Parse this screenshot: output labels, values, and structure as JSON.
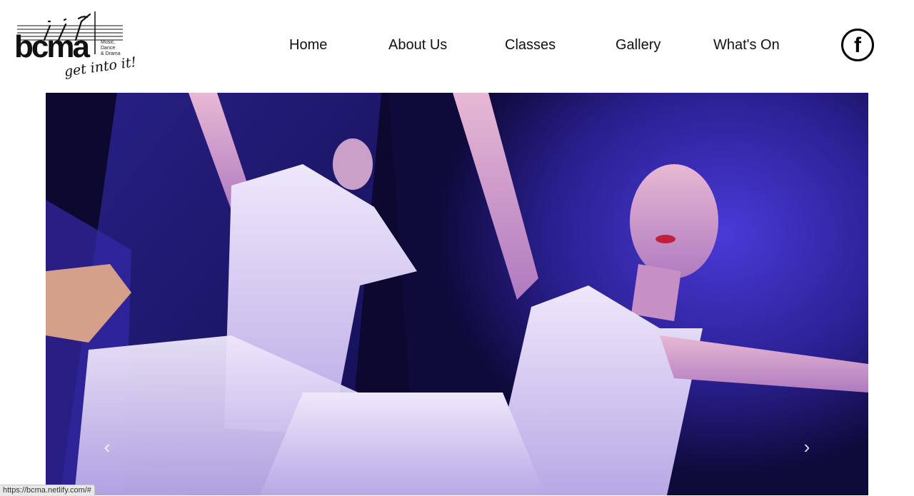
{
  "header": {
    "logo": {
      "wordmark": "bcma",
      "subtitle_lines": [
        "Music,",
        "Dance",
        "& Drama"
      ],
      "tagline": "get into it!"
    },
    "nav": [
      {
        "label": "Home"
      },
      {
        "label": "About Us"
      },
      {
        "label": "Classes"
      },
      {
        "label": "Gallery"
      },
      {
        "label": "What's On"
      }
    ],
    "social": {
      "icon": "facebook-icon",
      "glyph": "f"
    }
  },
  "carousel": {
    "prev_icon": "chevron-left-icon",
    "next_icon": "chevron-right-icon",
    "prev_glyph": "‹",
    "next_glyph": "›",
    "image_colors": {
      "backdrop": "#0c0830",
      "fabric": "#3a2fb8",
      "costume": "#e6def5",
      "skin": "#d9a7c8"
    }
  },
  "status_bar": {
    "url": "https://bcma.netlify.com/#"
  }
}
